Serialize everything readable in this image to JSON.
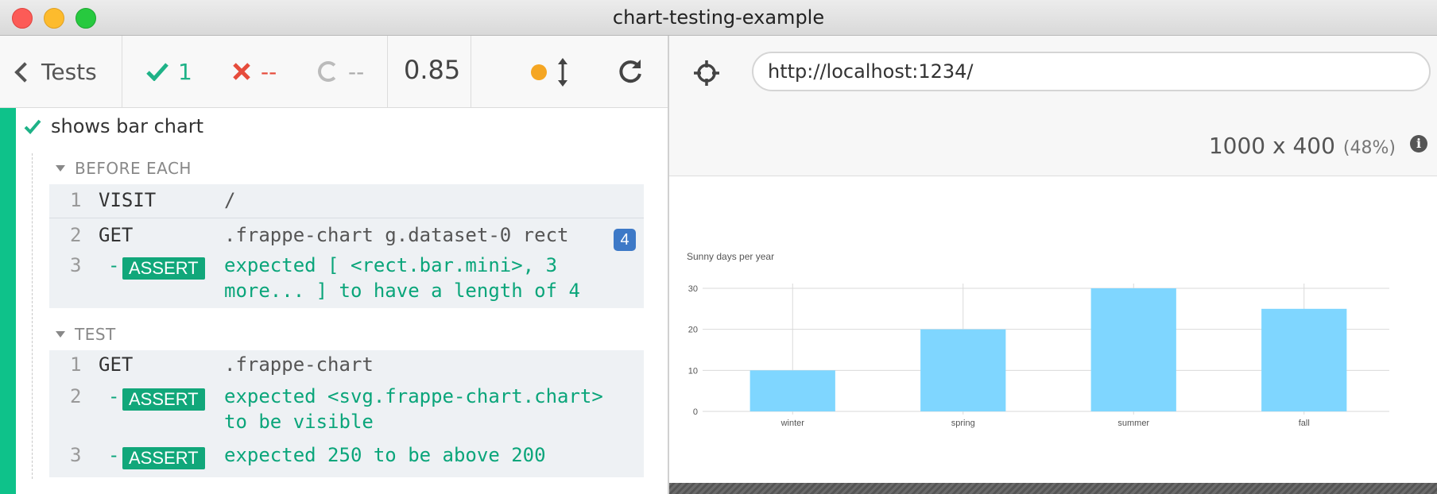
{
  "window": {
    "title": "chart-testing-example"
  },
  "reporter": {
    "back_label": "Tests",
    "passed_count": "1",
    "failed_count": "--",
    "pending_count": "--",
    "duration": "0.85"
  },
  "test": {
    "title": "shows bar chart",
    "before_each": {
      "label": "BEFORE EACH",
      "commands": [
        {
          "num": "1",
          "name": "VISIT",
          "message": "/"
        },
        {
          "num": "2",
          "name": "GET",
          "message": ".frappe-chart g.dataset-0 rect",
          "badge": "4"
        },
        {
          "num": "3",
          "name": "ASSERT",
          "message_line1": "expected [ <rect.bar.mini>, 3",
          "message_line2": "more... ] to have a length of 4"
        }
      ]
    },
    "test_body": {
      "label": "TEST",
      "commands": [
        {
          "num": "1",
          "name": "GET",
          "message": ".frappe-chart"
        },
        {
          "num": "2",
          "name": "ASSERT",
          "message_line1": "expected <svg.frappe-chart.chart>",
          "message_line2": "to be visible"
        },
        {
          "num": "3",
          "name": "ASSERT",
          "message": "expected 250 to be above 200"
        }
      ]
    }
  },
  "aut": {
    "url": "http://localhost:1234/",
    "viewport": "1000 x 400",
    "scale": "(48%)"
  },
  "chart_data": {
    "type": "bar",
    "title": "Sunny days per year",
    "categories": [
      "winter",
      "spring",
      "summer",
      "fall"
    ],
    "values": [
      10,
      20,
      30,
      25
    ],
    "yticks": [
      0,
      10,
      20,
      30
    ],
    "ylim": [
      0,
      30
    ],
    "xlabel": "",
    "ylabel": "",
    "bar_color": "#7fd6ff",
    "grid": true
  },
  "colors": {
    "pass": "#1eb287",
    "fail": "#e64c3c",
    "assert_badge": "#11a77a",
    "count_badge": "#3d79c7",
    "progress": "#0ec28a"
  },
  "icons": {
    "back": "chevron-left-icon",
    "passed": "check-icon",
    "failed": "x-icon",
    "pending": "spinner-icon",
    "scroll": "scroll-arrows-icon",
    "reload": "reload-icon",
    "selector": "crosshair-icon",
    "info": "info-icon"
  }
}
